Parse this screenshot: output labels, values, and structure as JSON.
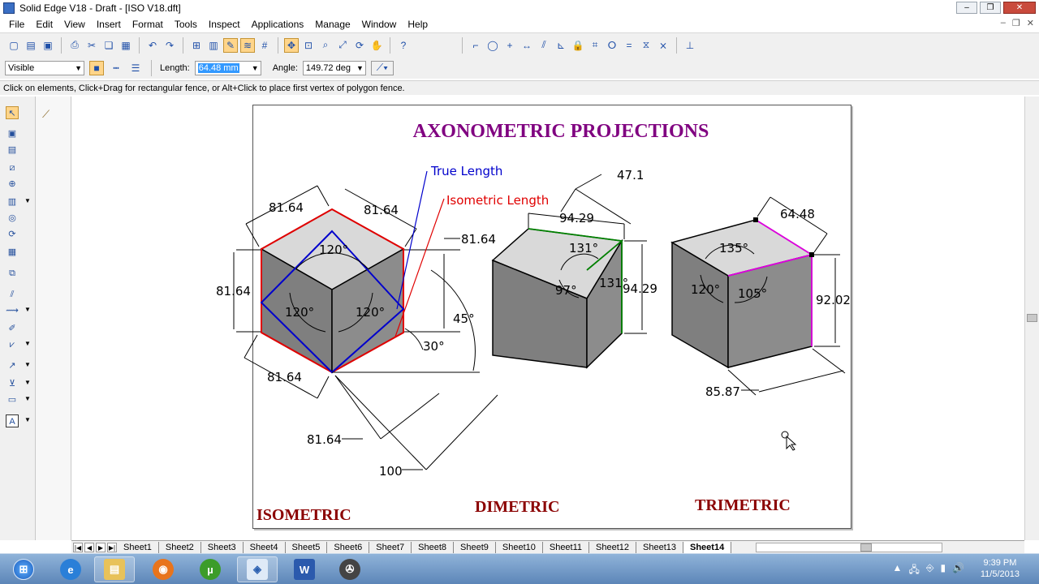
{
  "window": {
    "title": "Solid Edge V18 - Draft - [ISO V18.dft]"
  },
  "menu": [
    "File",
    "Edit",
    "View",
    "Insert",
    "Format",
    "Tools",
    "Inspect",
    "Applications",
    "Manage",
    "Window",
    "Help"
  ],
  "toolbar2": {
    "line_style": "Visible",
    "length_label": "Length:",
    "length_value": "64.48 mm",
    "angle_label": "Angle:",
    "angle_value": "149.72 deg"
  },
  "prompt": "Click on elements, Click+Drag for rectangular fence, or Alt+Click to place first vertex of polygon fence.",
  "drawing": {
    "heading": "AXONOMETRIC PROJECTIONS",
    "true_length": "True Length",
    "iso_length": "Isometric Length",
    "iso": {
      "caption": "ISOMETRIC",
      "d_top_left": "81.64",
      "d_top_right": "81.64",
      "d_right": "81.64",
      "d_left": "81.64",
      "d_bottom": "81.64",
      "d_lower": "81.64",
      "d_100": "100",
      "a_top": "120°",
      "a_left": "120°",
      "a_right": "120°",
      "a_45": "45°",
      "a_30": "30°"
    },
    "dim": {
      "caption": "DIMETRIC",
      "d_47": "47.1",
      "d_9429_top": "94.29",
      "d_9429_right": "94.29",
      "a_131a": "131°",
      "a_131b": "131°",
      "a_97": "97°"
    },
    "tri": {
      "caption": "TRIMETRIC",
      "d_6448": "64.48",
      "d_9202": "92.02",
      "d_8587": "85.87",
      "a_135": "135°",
      "a_120": "120°",
      "a_105": "105°"
    }
  },
  "sheets": [
    "Sheet1",
    "Sheet2",
    "Sheet3",
    "Sheet4",
    "Sheet5",
    "Sheet6",
    "Sheet7",
    "Sheet8",
    "Sheet9",
    "Sheet10",
    "Sheet11",
    "Sheet12",
    "Sheet13",
    "Sheet14"
  ],
  "active_sheet": "Sheet14",
  "clock": {
    "time": "9:39 PM",
    "date": "11/5/2013"
  },
  "colors": {
    "heading": "#800080",
    "caption": "#8b0000",
    "iso_edge": "#e00000",
    "true_line": "#0000cc",
    "dim_edge": "#008000",
    "tri_edge": "#e000e0"
  }
}
